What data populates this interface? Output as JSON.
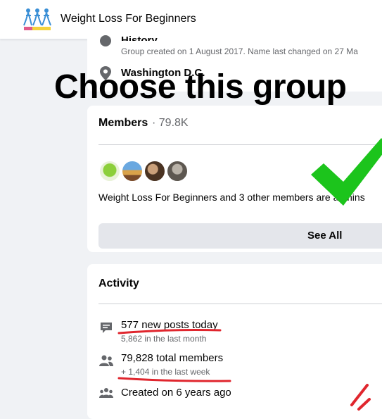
{
  "header": {
    "group_name": "Weight Loss For Beginners",
    "logo_icon": "group-logo-figures-icon"
  },
  "about": {
    "history_title": "History",
    "history_text": "Group created on 1 August 2017. Name last changed on 27 Ma",
    "location": "Washington D.C."
  },
  "overlay": {
    "caption": "Choose this group",
    "check_color": "#1cc41c",
    "underline_color": "#e0262e"
  },
  "members": {
    "label": "Members",
    "count": "· 79.8K",
    "admins_text": "Weight Loss For Beginners and 3 other members are admins",
    "see_all": "See All",
    "avatars": [
      "avatar-group-logo",
      "avatar-person-1",
      "avatar-person-2",
      "avatar-person-3"
    ]
  },
  "activity": {
    "title": "Activity",
    "items": [
      {
        "icon": "posts-chat-icon",
        "main": "577 new posts today",
        "sub": "5,862 in the last month"
      },
      {
        "icon": "members-people-icon",
        "main": "79,828 total members",
        "sub": "+ 1,404 in the last week"
      },
      {
        "icon": "group-created-icon",
        "main": "Created on 6 years ago",
        "sub": ""
      }
    ]
  },
  "colors": {
    "page_bg": "#f0f2f5",
    "card_bg": "#ffffff",
    "secondary_text": "#65676b",
    "button_bg": "#e4e6eb"
  }
}
